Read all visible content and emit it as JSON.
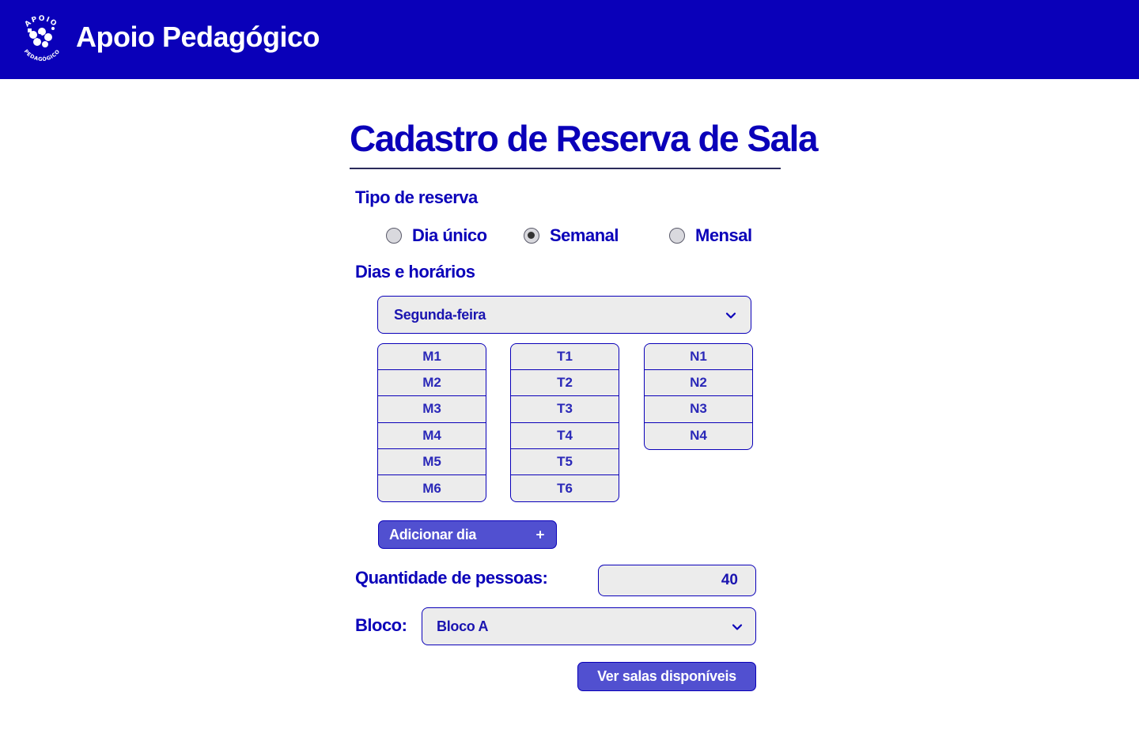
{
  "header": {
    "app_title": "Apoio Pedagógico",
    "logo_text_top": "APOIO",
    "logo_text_bottom": "PEDAGÓGICO",
    "background": "#0a00b9"
  },
  "form": {
    "title": "Cadastro de Reserva de Sala",
    "reservation_type": {
      "label": "Tipo de reserva",
      "options": [
        {
          "label": "Dia único",
          "checked": false
        },
        {
          "label": "Semanal",
          "checked": true
        },
        {
          "label": "Mensal",
          "checked": false
        }
      ]
    },
    "schedule": {
      "label": "Dias e horários",
      "day_select_value": "Segunda-feira",
      "morning": [
        "M1",
        "M2",
        "M3",
        "M4",
        "M5",
        "M6"
      ],
      "afternoon": [
        "T1",
        "T2",
        "T3",
        "T4",
        "T5",
        "T6"
      ],
      "night": [
        "N1",
        "N2",
        "N3",
        "N4"
      ],
      "add_day_label": "Adicionar dia",
      "add_day_icon": "plus-icon"
    },
    "people": {
      "label": "Quantidade de pessoas:",
      "value": "40"
    },
    "block": {
      "label": "Bloco:",
      "value": "Bloco A"
    },
    "submit_label": "Ver salas disponíveis"
  },
  "colors": {
    "primary": "#0a00b9",
    "button": "#5150d0",
    "field_bg": "#ececec"
  }
}
